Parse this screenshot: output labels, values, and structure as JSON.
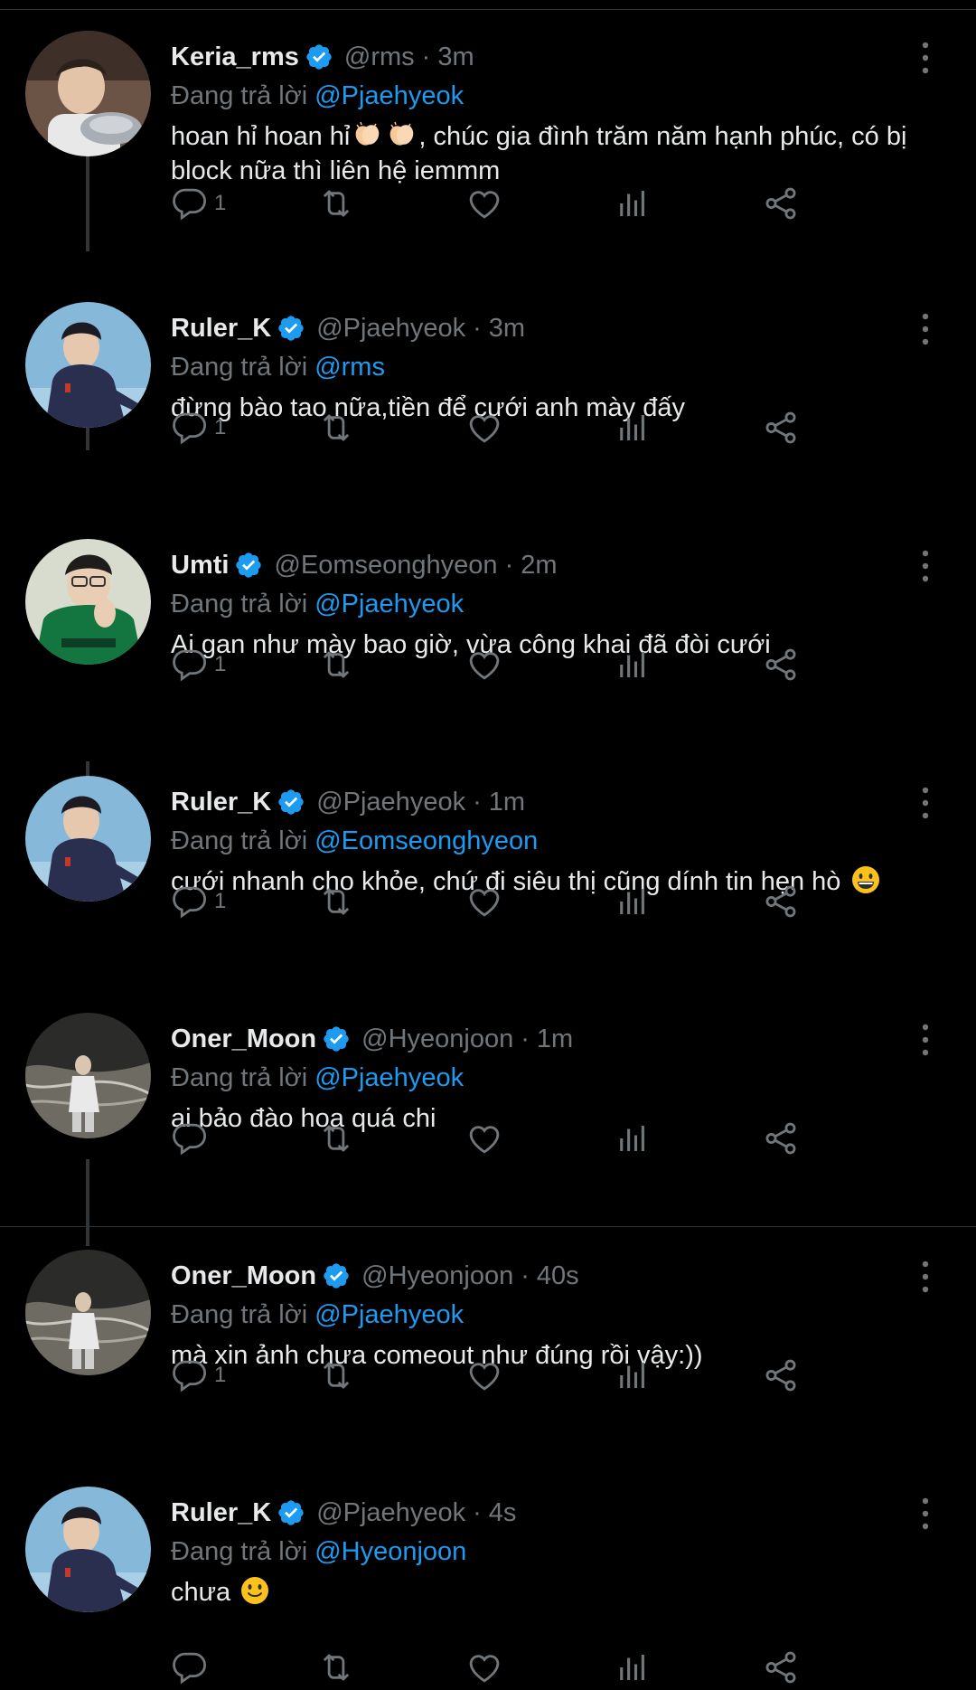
{
  "reply_prefix": "Đang trả lời",
  "colors": {
    "background": "#000000",
    "text": "#e7e9ea",
    "muted": "#71767b",
    "accent": "#1d9bf0"
  },
  "tweets": [
    {
      "name": "Keria_rms",
      "handle": "@rms",
      "time": "3m",
      "reply_to": "@Pjaehyeok",
      "text_parts": [
        "hoan hỉ hoan hỉ",
        ", chúc gia đình trăm năm hạnh phúc, có bị block nữa thì liên hệ iemmm"
      ],
      "emoji": "clapping-hands x2",
      "replies": "1",
      "avatar_icon": "profile-photo-boy-with-plate"
    },
    {
      "name": "Ruler_K",
      "handle": "@Pjaehyeok",
      "time": "3m",
      "reply_to": "@rms",
      "text": "đừng bào tao nữa,tiền để cưới anh mày đấy",
      "replies": "1",
      "avatar_icon": "profile-photo-man-navy-jacket"
    },
    {
      "name": "Umti",
      "handle": "@Eomseonghyeon",
      "time": "2m",
      "reply_to": "@Pjaehyeok",
      "text": "Ai gan như mày bao giờ, vừa công khai đã đòi cưới",
      "replies": "1",
      "avatar_icon": "profile-photo-man-green-jersey"
    },
    {
      "name": "Ruler_K",
      "handle": "@Pjaehyeok",
      "time": "1m",
      "reply_to": "@Eomseonghyeon",
      "text": "cưới nhanh cho khỏe, chứ đi siêu thị cũng dính tin hẹn hò",
      "emoji": "grinning-face",
      "replies": "1",
      "avatar_icon": "profile-photo-man-navy-jacket"
    },
    {
      "name": "Oner_Moon",
      "handle": "@Hyeonjoon",
      "time": "1m",
      "reply_to": "@Pjaehyeok",
      "text": "ai bảo đào hoa quá chi",
      "replies": "",
      "avatar_icon": "profile-photo-man-by-water"
    },
    {
      "name": "Oner_Moon",
      "handle": "@Hyeonjoon",
      "time": "40s",
      "reply_to": "@Pjaehyeok",
      "text": "mà xin ảnh chưa comeout như đúng rồi vậy:))",
      "replies": "1",
      "avatar_icon": "profile-photo-man-by-water"
    },
    {
      "name": "Ruler_K",
      "handle": "@Pjaehyeok",
      "time": "4s",
      "reply_to": "@Hyeonjoon",
      "text": "chưa",
      "emoji": "slightly-smiling-face",
      "replies": "",
      "avatar_icon": "profile-photo-man-navy-jacket"
    }
  ]
}
